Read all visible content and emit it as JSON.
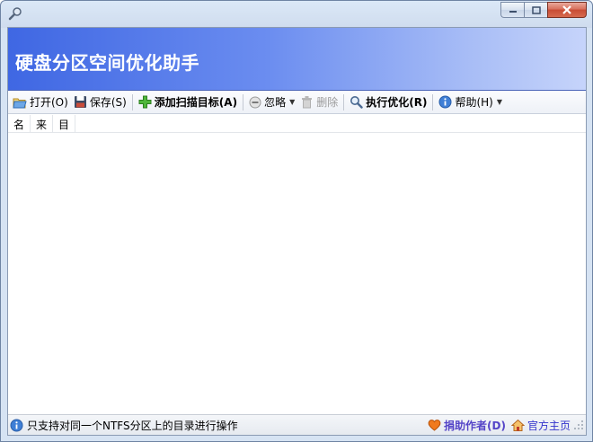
{
  "window": {
    "title": "硬盘分区空间优化助手",
    "controls": {
      "minimize": "minimize-icon",
      "maximize": "maximize-icon",
      "close": "close-icon"
    }
  },
  "banner": {
    "title": "硬盘分区空间优化助手",
    "gradient_from": "#3f67e3",
    "gradient_to": "#c6d4fb"
  },
  "toolbar": {
    "open": "打开(O)",
    "save": "保存(S)",
    "add_target": "添加扫描目标(A)",
    "ignore": "忽略",
    "delete": "删除",
    "optimize": "执行优化(R)",
    "help": "帮助(H)"
  },
  "list": {
    "columns": [
      "名",
      "来",
      "目"
    ],
    "rows": []
  },
  "status": {
    "message": "只支持对同一个NTFS分区上的目录进行操作",
    "donate": "捐助作者(D)",
    "homepage": "官方主页"
  },
  "colors": {
    "link": "#3333cc",
    "donate": "#5545c8",
    "close_button": "#c84c35"
  }
}
